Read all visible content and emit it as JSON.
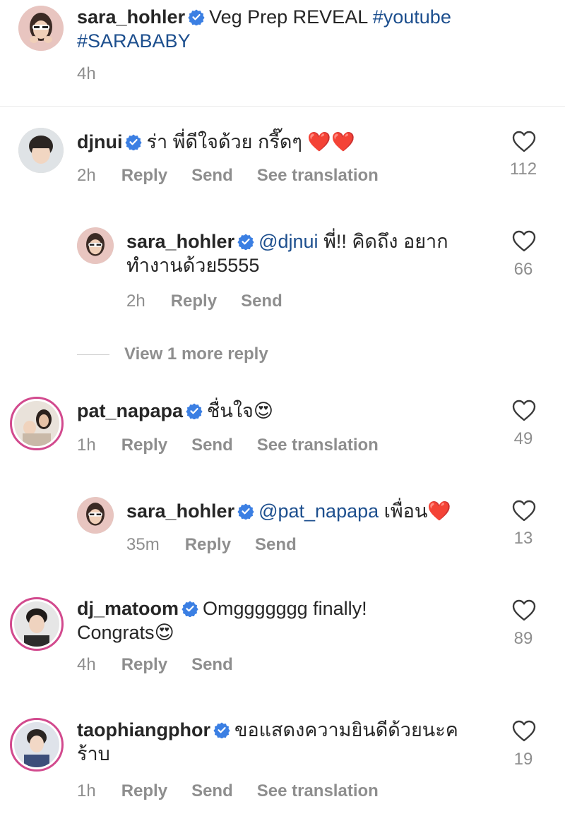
{
  "post": {
    "username": "sara_hohler",
    "caption": "Veg Prep REVEAL",
    "hashtags": [
      "#youtube",
      "#SARABABY"
    ],
    "time": "4h"
  },
  "comments": [
    {
      "username": "djnui",
      "text": "ร่า พี่ดีใจด้วย กรี๊ดๆ",
      "emoji": "❤️❤️",
      "time": "2h",
      "reply": "Reply",
      "send": "Send",
      "translate": "See translation",
      "likes": "112"
    },
    {
      "username": "sara_hohler",
      "mention": "@djnui",
      "text_line1": "พี่!! คิดถึง อยาก",
      "text_line2": "ทำงานด้วย5555",
      "time": "2h",
      "reply": "Reply",
      "send": "Send",
      "likes": "66"
    },
    {
      "username": "pat_napapa",
      "text": "ชื่นใจ",
      "emoji": "😍",
      "time": "1h",
      "reply": "Reply",
      "send": "Send",
      "translate": "See translation",
      "likes": "49"
    },
    {
      "username": "sara_hohler",
      "mention": "@pat_napapa",
      "text": "เพื่อน",
      "emoji": "❤️",
      "time": "35m",
      "reply": "Reply",
      "send": "Send",
      "likes": "13"
    },
    {
      "username": "dj_matoom",
      "text_line1": "Omggggggg finally!",
      "text_line2": "Congrats",
      "emoji": "😍",
      "time": "4h",
      "reply": "Reply",
      "send": "Send",
      "likes": "89"
    },
    {
      "username": "taophiangphor",
      "text_line1": "ขอแสดงความยินดีด้วยนะค",
      "text_line2": "ร้าบ",
      "time": "1h",
      "reply": "Reply",
      "send": "Send",
      "translate": "See translation",
      "likes": "19"
    }
  ],
  "view_more": "View 1 more reply",
  "colors": {
    "accent_link": "#1d4f8e",
    "verified": "#3b7fe3",
    "meta": "#8e8e8e",
    "story_ring": "#d24a8e"
  }
}
